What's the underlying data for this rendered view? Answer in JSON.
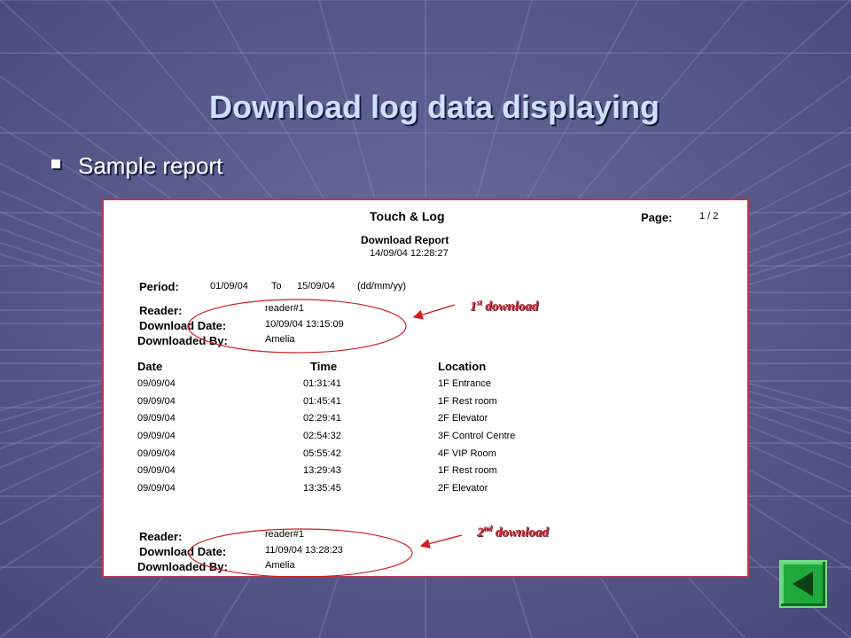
{
  "slide": {
    "title": "Download log data displaying",
    "bullet": "Sample report"
  },
  "report": {
    "title": "Touch & Log",
    "page_label": "Page:",
    "page_value": "1 / 2",
    "subtitle": "Download Report",
    "timestamp": "14/09/04 12:28:27",
    "period": {
      "label": "Period:",
      "from": "01/09/04",
      "to_word": "To",
      "to": "15/09/04",
      "format": "(dd/mm/yy)"
    },
    "download1": {
      "reader_label": "Reader:",
      "reader": "reader#1",
      "date_label": "Download Date:",
      "date": "10/09/04 13:15:09",
      "by_label": "Downloaded By:",
      "by": "Amelia"
    },
    "columns": [
      "Date",
      "Time",
      "Location"
    ],
    "rows": [
      [
        "09/09/04",
        "01:31:41",
        "1F Entrance"
      ],
      [
        "09/09/04",
        "01:45:41",
        "1F Rest room"
      ],
      [
        "09/09/04",
        "02:29:41",
        "2F Elevator"
      ],
      [
        "09/09/04",
        "02:54:32",
        "3F Control Centre"
      ],
      [
        "09/09/04",
        "05:55:42",
        "4F VIP Room"
      ],
      [
        "09/09/04",
        "13:29:43",
        "1F Rest room"
      ],
      [
        "09/09/04",
        "13:35:45",
        "2F Elevator"
      ]
    ],
    "download2": {
      "reader_label": "Reader:",
      "reader": "reader#1",
      "date_label": "Download Date:",
      "date": "11/09/04 13:28:23",
      "by_label": "Downloaded By:",
      "by": "Amelia"
    }
  },
  "annotations": {
    "first": {
      "num": "1",
      "sup": "st",
      "text": " download"
    },
    "second": {
      "num": "2",
      "sup": "nd",
      "text": " download"
    }
  },
  "colors": {
    "background": "#5a5a8c",
    "title": "#cfe0ff",
    "annotation": "#c0303a",
    "back_button": "#1fa83b"
  },
  "icons": {
    "back": "triangle-left-icon"
  }
}
